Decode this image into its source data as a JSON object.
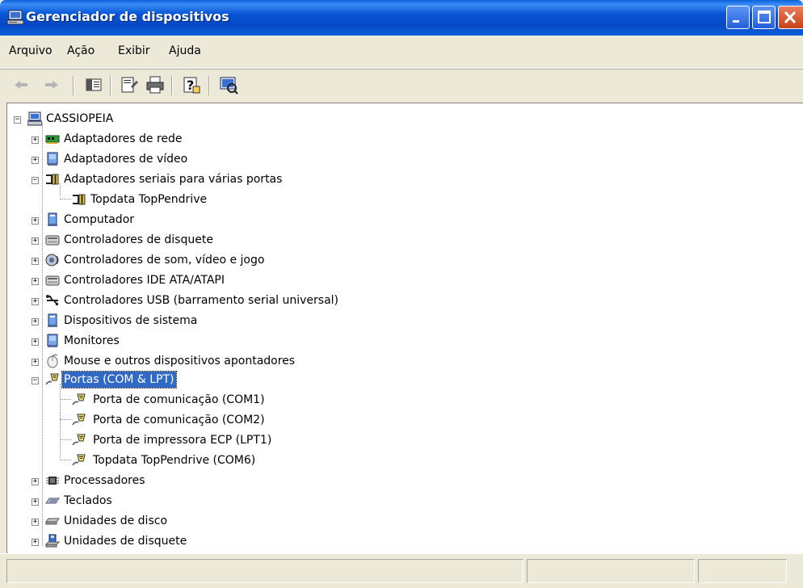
{
  "window": {
    "title": "Gerenciador de dispositivos"
  },
  "menu": [
    {
      "label": "Arquivo"
    },
    {
      "label": "Ação"
    },
    {
      "label": "Exibir"
    },
    {
      "label": "Ajuda"
    }
  ],
  "toolbar": {
    "buttons": [
      "back-icon",
      "forward-icon",
      "show-hide-tree-icon",
      "properties-icon",
      "print-icon",
      "help-icon",
      "scan-hardware-icon"
    ]
  },
  "tree": {
    "root": "CASSIOPEIA",
    "categories": [
      {
        "label": "Adaptadores de rede",
        "expanded": false,
        "icon": "network-adapter-icon"
      },
      {
        "label": "Adaptadores de vídeo",
        "expanded": false,
        "icon": "display-adapter-icon"
      },
      {
        "label": "Adaptadores seriais para várias portas",
        "expanded": true,
        "icon": "multiport-serial-icon",
        "children": [
          {
            "label": "Topdata TopPendrive",
            "icon": "multiport-serial-icon"
          }
        ]
      },
      {
        "label": "Computador",
        "expanded": false,
        "icon": "computer-icon"
      },
      {
        "label": "Controladores de disquete",
        "expanded": false,
        "icon": "floppy-controller-icon"
      },
      {
        "label": "Controladores de som, vídeo e jogo",
        "expanded": false,
        "icon": "sound-icon"
      },
      {
        "label": "Controladores IDE ATA/ATAPI",
        "expanded": false,
        "icon": "ide-controller-icon"
      },
      {
        "label": "Controladores USB (barramento serial universal)",
        "expanded": false,
        "icon": "usb-icon"
      },
      {
        "label": "Dispositivos de sistema",
        "expanded": false,
        "icon": "system-device-icon"
      },
      {
        "label": "Monitores",
        "expanded": false,
        "icon": "monitor-icon"
      },
      {
        "label": "Mouse e outros dispositivos apontadores",
        "expanded": false,
        "icon": "mouse-icon"
      },
      {
        "label": "Portas (COM & LPT)",
        "expanded": true,
        "selected": true,
        "icon": "port-icon",
        "children": [
          {
            "label": "Porta de comunicação (COM1)",
            "icon": "port-icon"
          },
          {
            "label": "Porta de comunicação (COM2)",
            "icon": "port-icon"
          },
          {
            "label": "Porta de impressora ECP (LPT1)",
            "icon": "port-icon"
          },
          {
            "label": "Topdata TopPendrive (COM6)",
            "icon": "port-icon"
          }
        ]
      },
      {
        "label": "Processadores",
        "expanded": false,
        "icon": "processor-icon"
      },
      {
        "label": "Teclados",
        "expanded": false,
        "icon": "keyboard-icon"
      },
      {
        "label": "Unidades de disco",
        "expanded": false,
        "icon": "disk-drive-icon"
      },
      {
        "label": "Unidades de disquete",
        "expanded": false,
        "icon": "floppy-drive-icon"
      }
    ]
  },
  "colors": {
    "titlebar": "#0a5fd8",
    "selection": "#316ac5",
    "chrome": "#ece9d8"
  }
}
